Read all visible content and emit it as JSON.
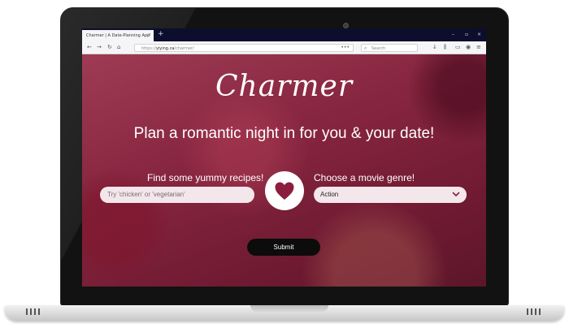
{
  "browser": {
    "tab_title": "Charmer | A Date-Planning App",
    "tab_close": "×",
    "new_tab": "+",
    "window_controls": [
      "–",
      "▫",
      "×"
    ],
    "url_prefix": "https://",
    "url_host": "yiying.ca",
    "url_path": "/charmer/",
    "address_more": "•••",
    "search_placeholder": "Search"
  },
  "app": {
    "logo": "Charmer",
    "tagline": "Plan a romantic night in for you & your date!",
    "recipes_label": "Find some yummy recipes!",
    "recipe_input_placeholder": "Try 'chicken' or 'vegetarian'",
    "movie_label": "Choose a movie genre!",
    "movie_genre_selected": "Action",
    "submit_label": "Submit"
  },
  "colors": {
    "accent": "#8b1e3f",
    "tab_bar": "#0d0d2e",
    "field_bg": "#f3e7ec",
    "button_bg": "#0c0c0c"
  }
}
